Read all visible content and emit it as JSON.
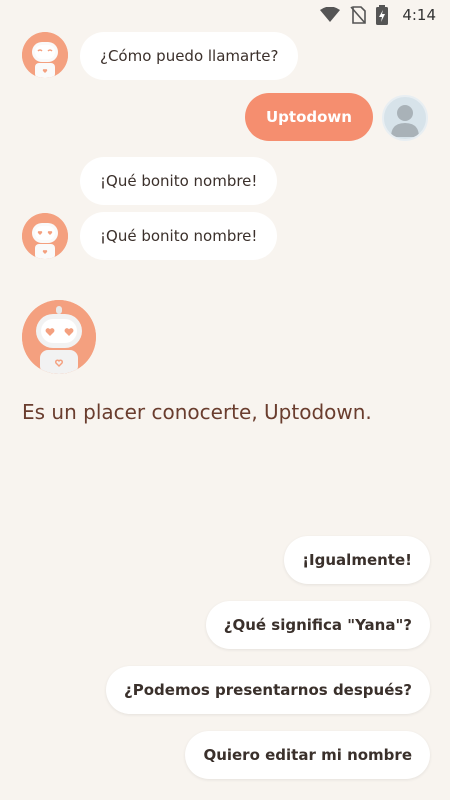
{
  "status_bar": {
    "time": "4:14",
    "icons": [
      "wifi-icon",
      "no-sim-icon",
      "battery-charging-icon"
    ]
  },
  "colors": {
    "background": "#f8f4ef",
    "accent": "#f58e6f",
    "bot_avatar": "#f4a07f",
    "message_text": "#6a3d2e"
  },
  "chat": {
    "messages": [
      {
        "from": "bot",
        "text": "¿Cómo puedo llamarte?"
      },
      {
        "from": "user",
        "text": "Uptodown"
      },
      {
        "from": "bot",
        "text": "¡Qué bonito nombre!"
      },
      {
        "from": "bot",
        "text": "¡Qué bonito nombre!"
      }
    ],
    "highlight_message": "Es un placer conocerte, Uptodown."
  },
  "quick_replies": [
    "¡Igualmente!",
    "¿Qué significa \"Yana\"?",
    "¿Podemos presentarnos después?",
    "Quiero editar mi nombre"
  ]
}
